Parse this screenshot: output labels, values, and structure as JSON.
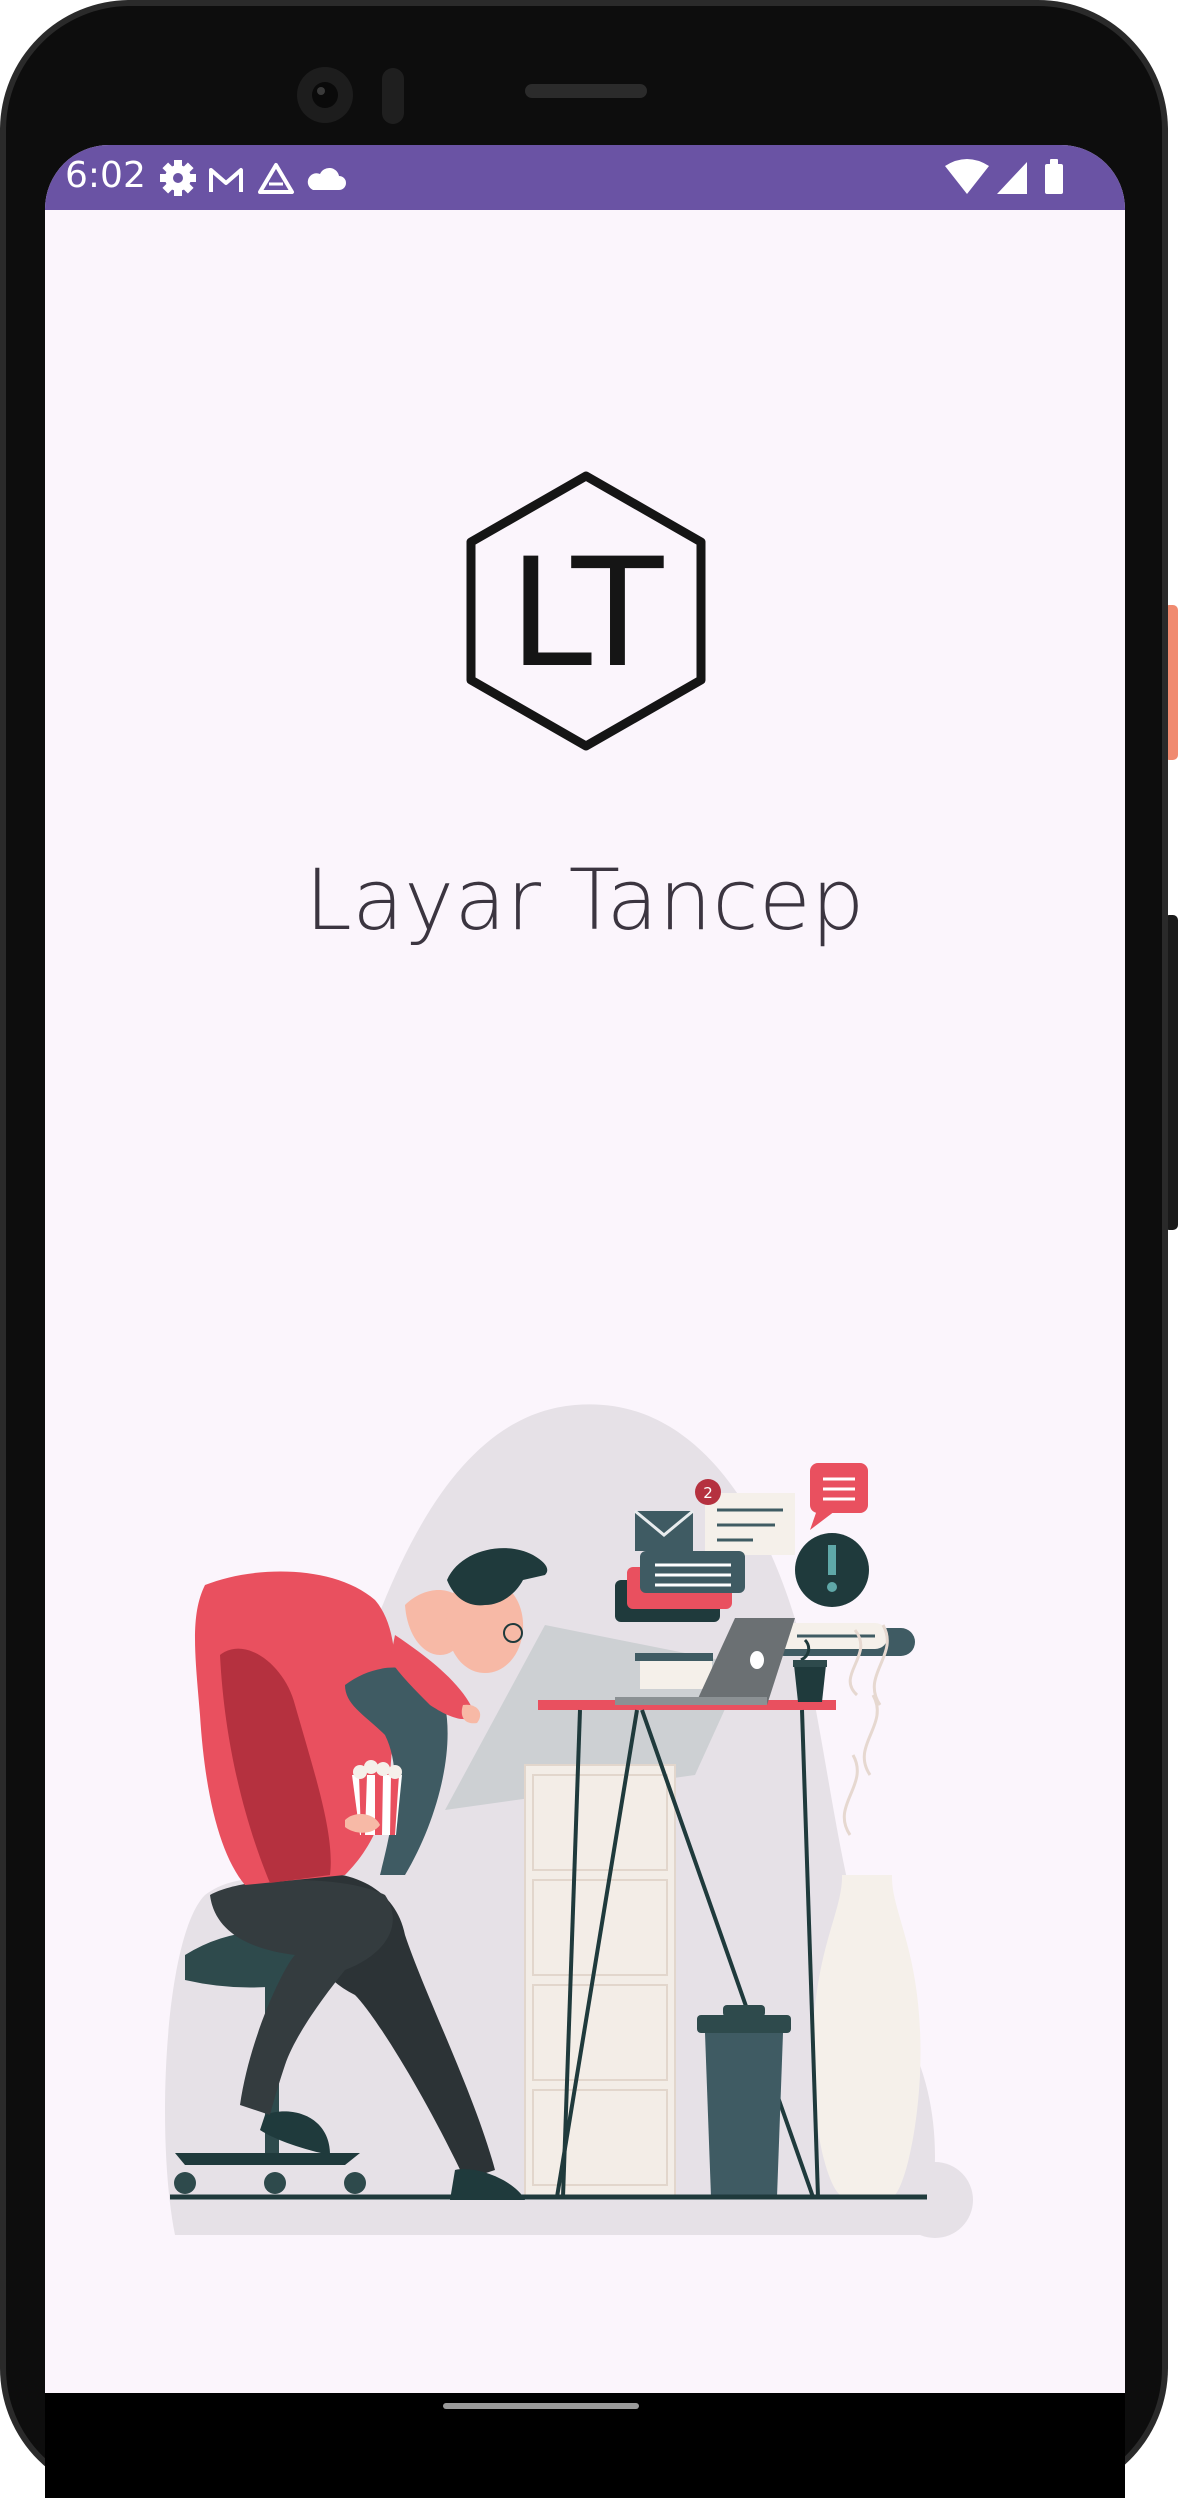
{
  "status_bar": {
    "time": "6:02",
    "left_icons": [
      "settings-icon",
      "gmail-icon",
      "drive-icon",
      "cloud-icon"
    ],
    "right_icons": [
      "wifi-icon",
      "cellular-signal-icon",
      "battery-icon"
    ]
  },
  "splash": {
    "logo_text": "LT",
    "app_name": "Layar Tancep"
  },
  "illustration": {
    "notification_badge": "2"
  },
  "colors": {
    "status_bar": "#6a53a4",
    "screen_background": "#fbf5fc",
    "title_text": "#3b3540",
    "accent_red": "#e9505f",
    "dark_teal": "#3f5b63"
  }
}
